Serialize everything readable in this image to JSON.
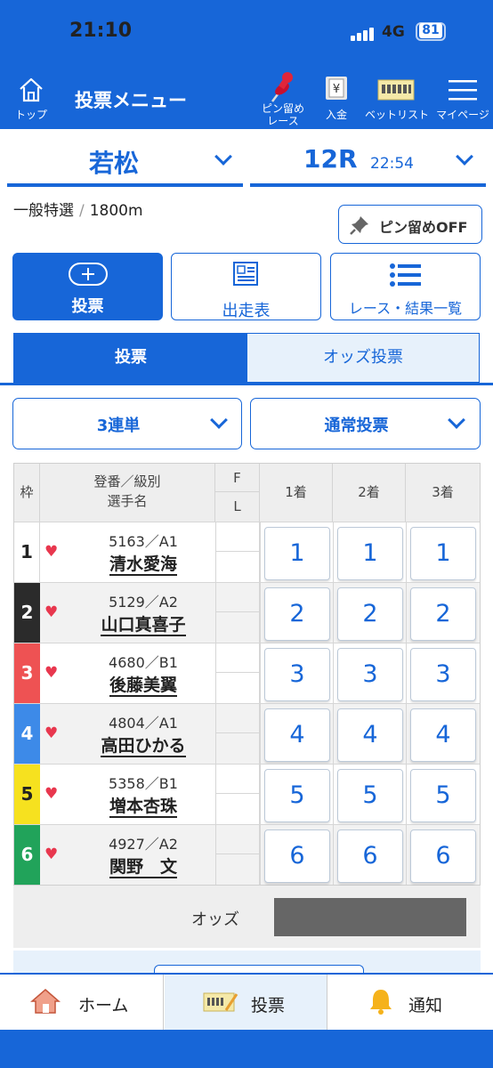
{
  "status_bar": {
    "time": "21:10",
    "network": "4G",
    "battery": "81"
  },
  "header": {
    "home_label": "トップ",
    "title": "投票メニュー",
    "pin_race_label_1": "ピン留め",
    "pin_race_label_2": "レース",
    "deposit_label": "入金",
    "bet_list_label": "ベットリスト",
    "mypage_label": "マイページ"
  },
  "race": {
    "venue": "若松",
    "race_number": "12R",
    "race_time": "22:54",
    "race_type": "一般特選",
    "separator": "/",
    "distance": "1800m",
    "pin_off_label": "ピン留めOFF"
  },
  "mode_buttons": {
    "vote": "投票",
    "entry_table": "出走表",
    "race_results": "レース・結果一覧"
  },
  "tabs": {
    "vote": "投票",
    "odds_vote": "オッズ投票"
  },
  "selects": {
    "bet_type": "3連単",
    "vote_method": "通常投票"
  },
  "table": {
    "col_frame": "枠",
    "col_player_1": "登番／級別",
    "col_player_2": "選手名",
    "col_f": "F",
    "col_l": "L",
    "col_first": "1着",
    "col_second": "2着",
    "col_third": "3着",
    "rows": [
      {
        "frame": "1",
        "reg": "5163／A1",
        "name": "清水愛海",
        "bg": "#ffffff",
        "fg": "#222222"
      },
      {
        "frame": "2",
        "reg": "5129／A2",
        "name": "山口真喜子",
        "bg": "#2b2b2b",
        "fg": "#ffffff"
      },
      {
        "frame": "3",
        "reg": "4680／B1",
        "name": "後藤美翼",
        "bg": "#ee5253",
        "fg": "#ffffff"
      },
      {
        "frame": "4",
        "reg": "4804／A1",
        "name": "高田ひかる",
        "bg": "#3d8ae8",
        "fg": "#ffffff"
      },
      {
        "frame": "5",
        "reg": "5358／B1",
        "name": "増本杏珠",
        "bg": "#f6e11f",
        "fg": "#222222"
      },
      {
        "frame": "6",
        "reg": "4927／A2",
        "name": "関野　文",
        "bg": "#21a35a",
        "fg": "#ffffff"
      }
    ],
    "odds_label": "オッズ"
  },
  "bottom_nav": {
    "home": "ホーム",
    "vote": "投票",
    "notify": "通知"
  },
  "colors": {
    "primary": "#1766d8",
    "heart": "#e8374e",
    "odds_box": "#666666"
  }
}
